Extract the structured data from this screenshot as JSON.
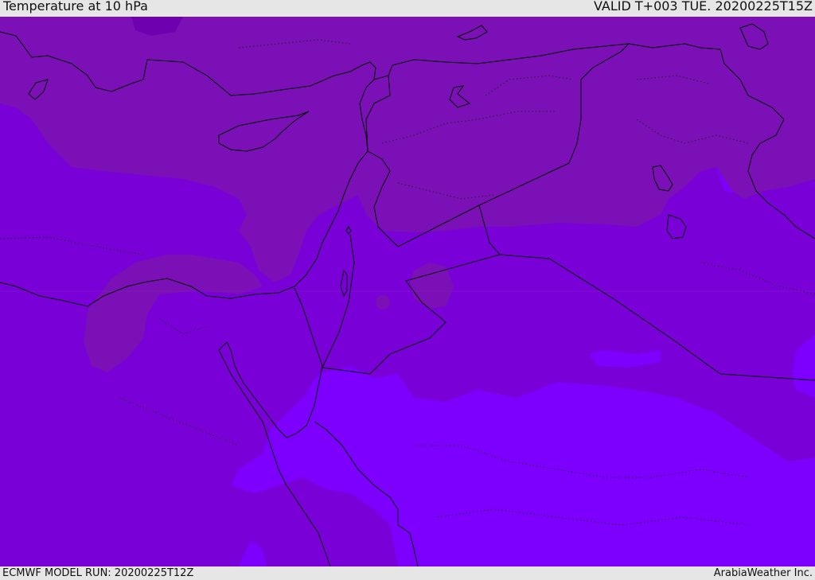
{
  "header": {
    "title": "Temperature at 10 hPa",
    "valid_time": "VALID T+003 TUE. 20200225T15Z"
  },
  "footer": {
    "model_run": "ECMWF MODEL RUN: 20200225T12Z",
    "credit": "ArabiaWeather Inc."
  },
  "map": {
    "variable": "Temperature",
    "level": "10 hPa",
    "colors": {
      "band_warmest_north": "#7a10b5",
      "band_mid": "#7a00d8",
      "band_coldest_south": "#7d00ff",
      "coastline": "#000000",
      "border": "#000000"
    }
  }
}
